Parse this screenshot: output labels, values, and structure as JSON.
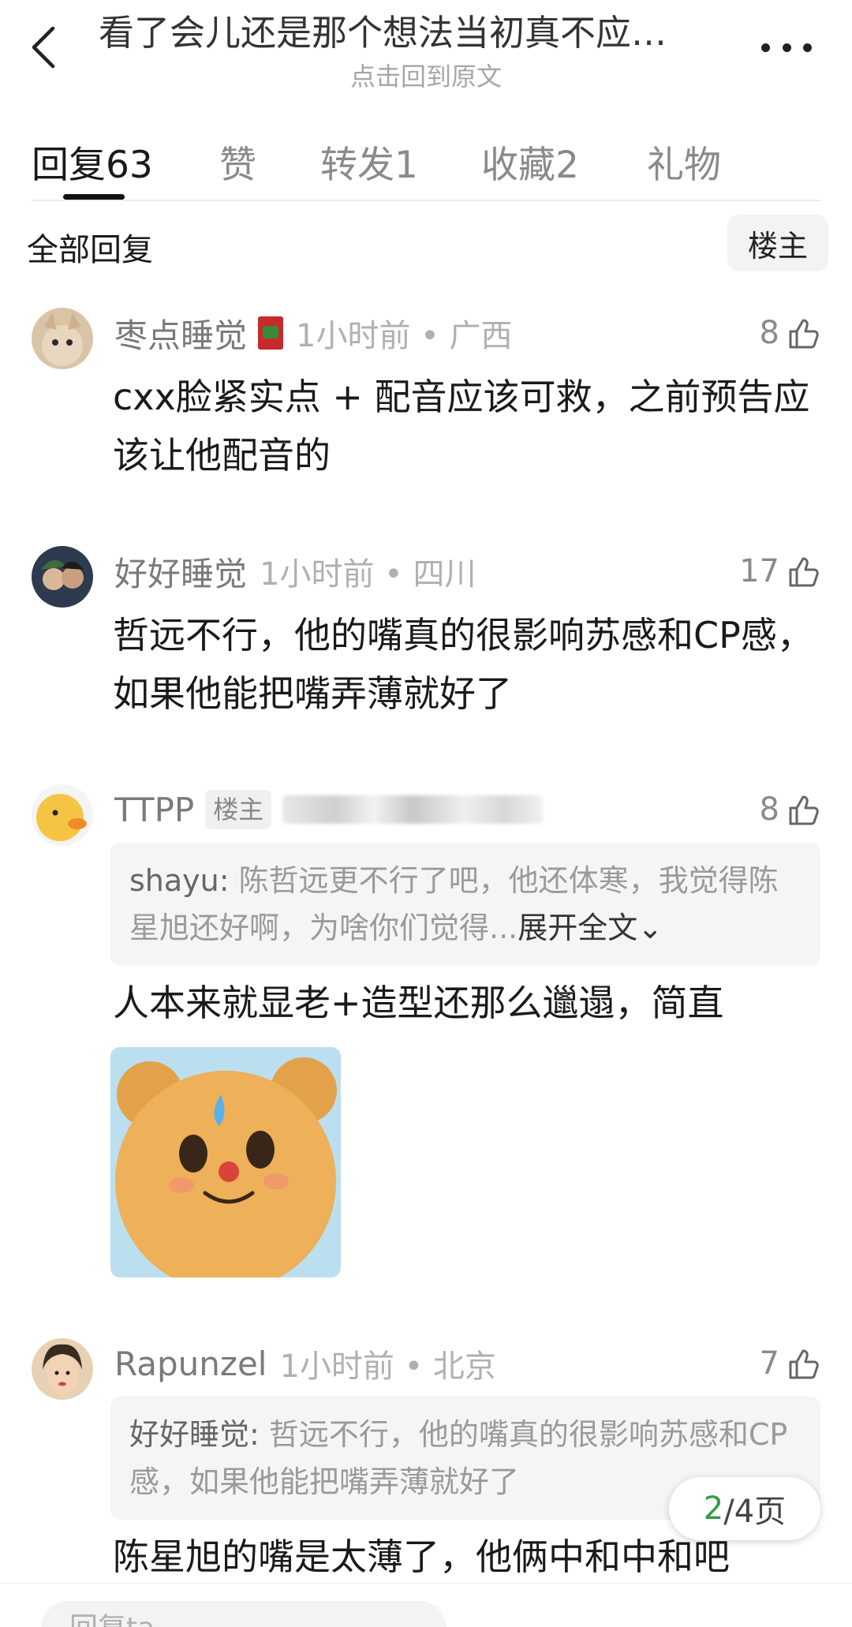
{
  "header": {
    "title": "看了会儿还是那个想法当初真不应…",
    "subtitle": "点击回到原文"
  },
  "tabs": [
    {
      "label": "回复",
      "count": "63"
    },
    {
      "label": "赞",
      "count": ""
    },
    {
      "label": "转发",
      "count": "1"
    },
    {
      "label": "收藏",
      "count": "2"
    },
    {
      "label": "礼物",
      "count": ""
    }
  ],
  "section": {
    "title": "全部回复",
    "owner_filter": "楼主"
  },
  "comments": [
    {
      "name": "枣点睡觉",
      "meta": "1小时前 • 广西",
      "likes": "8",
      "body": "cxx脸紧实点 + 配音应该可救，之前预告应该让他配音的"
    },
    {
      "name": "好好睡觉",
      "meta": "1小时前 • 四川",
      "likes": "17",
      "body": "哲远不行，他的嘴真的很影响苏感和CP感，如果他能把嘴弄薄就好了"
    },
    {
      "name": "TTPP",
      "badge": "楼主",
      "likes": "8",
      "quote_user": "shayu: ",
      "quote_text": "陈哲远更不行了吧，他还体寒，我觉得陈星旭还好啊，为啥你们觉得...",
      "quote_expand": "展开全文⌄",
      "body": "人本来就显老+造型还那么邋遢，简直"
    },
    {
      "name": "Rapunzel",
      "meta": "1小时前 • 北京",
      "likes": "7",
      "quote_user": "好好睡觉: ",
      "quote_text": "哲远不行，他的嘴真的很影响苏感和CP感，如果他能把嘴弄薄就好了",
      "body": "陈星旭的嘴是太薄了，他俩中和中和吧"
    }
  ],
  "pager": {
    "current": "2",
    "total": "/4页"
  },
  "reply_box": {
    "placeholder": "回复ta"
  }
}
